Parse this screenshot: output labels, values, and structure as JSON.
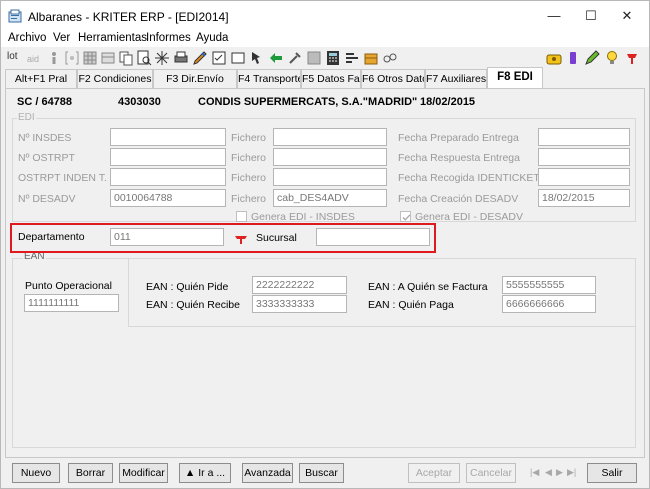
{
  "window": {
    "title": "Albaranes - KRITER ERP  -  [EDI2014]"
  },
  "menu": [
    "Archivo",
    "Ver",
    "Herramientas",
    "Informes",
    "Ayuda"
  ],
  "toolbar_left_label": "lot",
  "tabs": [
    "Alt+F1 Pral",
    "F2 Condiciones",
    "F3 Dir.Envío",
    "F4 Transporte",
    "F5 Datos Fac.",
    "F6 Otros Datos",
    "F7 Auxiliares",
    "F8 EDI"
  ],
  "header": {
    "code": "SC / 64788",
    "number": "4303030",
    "customer": "CONDIS SUPERMERCATS, S.A.\"MADRID\"",
    "date": "18/02/2015"
  },
  "edi": {
    "group_title": "EDI",
    "labels": {
      "insdes": "Nº INSDES",
      "ostrpt": "Nº OSTRPT",
      "ostrpt_inden": "OSTRPT INDEN T.",
      "desadv": "Nº DESADV",
      "fichero": "Fichero",
      "fecha_preparado": "Fecha Preparado Entrega",
      "fecha_respuesta": "Fecha Respuesta Entrega",
      "fecha_recogida": "Fecha Recogida IDENTICKET",
      "fecha_creacion": "Fecha Creación DESADV"
    },
    "values": {
      "insdes": "",
      "ostrpt": "",
      "ostrpt_inden": "",
      "desadv": "0010064788",
      "fichero1": "",
      "fichero2": "",
      "fichero3": "",
      "fichero4": "cab_DES4ADV",
      "fecha_preparado": "",
      "fecha_respuesta": "",
      "fecha_recogida": "",
      "fecha_creacion": "18/02/2015"
    },
    "genera_insdes": "Genera EDI - INSDES",
    "genera_desadv": "Genera EDI - DESADV"
  },
  "dept": {
    "label": "Departamento",
    "value": "011",
    "sucursal_label": "Sucursal",
    "sucursal_value": ""
  },
  "ean": {
    "group_title": "EAN",
    "punto_label": "Punto Operacional",
    "punto_value": "1111111111",
    "quien_pide_label": "EAN : Quién Pide",
    "quien_pide_value": "2222222222",
    "quien_recibe_label": "EAN : Quién Recibe",
    "quien_recibe_value": "3333333333",
    "quien_factura_label": "EAN : A Quién se Factura",
    "quien_factura_value": "5555555555",
    "quien_paga_label": "EAN : Quién Paga",
    "quien_paga_value": "6666666666"
  },
  "buttons": {
    "nuevo": "Nuevo",
    "borrar": "Borrar",
    "modificar": "Modificar",
    "ir_a": "▲ Ir a ...",
    "avanzada": "Avanzada",
    "buscar": "Buscar",
    "aceptar": "Aceptar",
    "cancelar": "Cancelar",
    "salir": "Salir"
  },
  "nav_arrows": [
    "|◀",
    "◀",
    "▶",
    "▶|"
  ]
}
